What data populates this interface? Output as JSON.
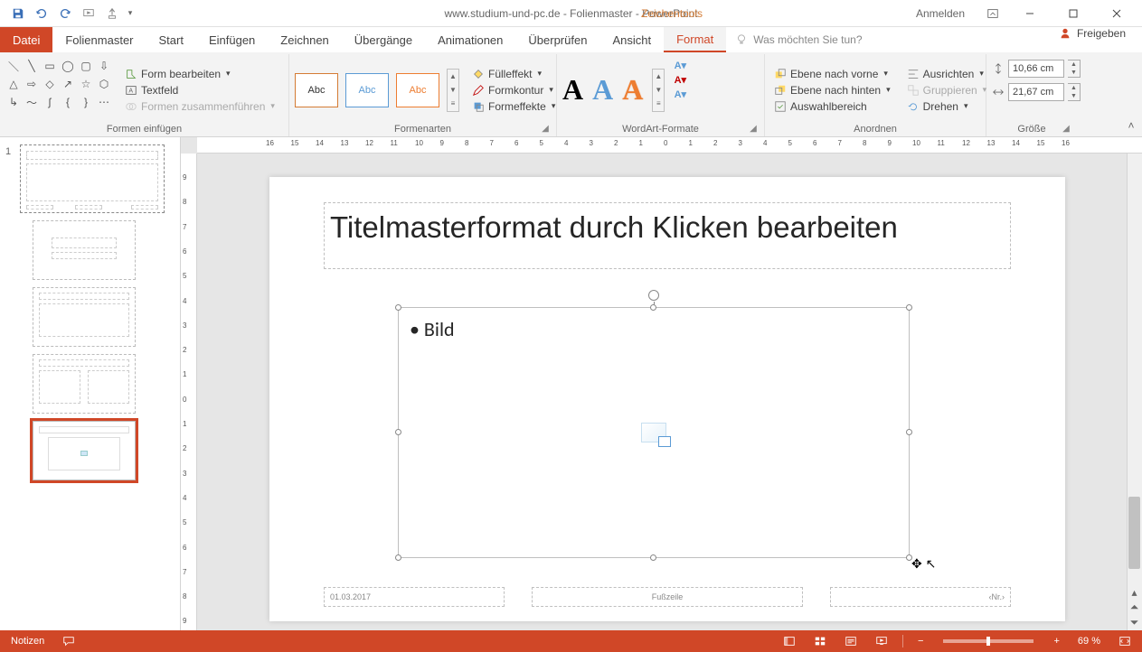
{
  "title": "www.studium-und-pc.de - Folienmaster - PowerPoint",
  "tool_context": "Zeichentools",
  "signin": "Anmelden",
  "tabs": {
    "file": "Datei",
    "items": [
      "Folienmaster",
      "Start",
      "Einfügen",
      "Zeichnen",
      "Übergänge",
      "Animationen",
      "Überprüfen",
      "Ansicht",
      "Format"
    ],
    "active": "Format",
    "tellme_placeholder": "Was möchten Sie tun?",
    "share": "Freigeben"
  },
  "ribbon": {
    "groups": {
      "insert_shapes": {
        "label": "Formen einfügen",
        "edit_shape": "Form bearbeiten",
        "textbox": "Textfeld",
        "merge_shapes": "Formen zusammenführen"
      },
      "shape_styles": {
        "label": "Formenarten",
        "abc": "Abc",
        "fill": "Fülleffekt",
        "outline": "Formkontur",
        "effects": "Formeffekte"
      },
      "wordart_styles": {
        "label": "WordArt-Formate"
      },
      "arrange": {
        "label": "Anordnen",
        "bring_forward": "Ebene nach vorne",
        "send_backward": "Ebene nach hinten",
        "selection_pane": "Auswahlbereich",
        "align": "Ausrichten",
        "group": "Gruppieren",
        "rotate": "Drehen"
      },
      "size": {
        "label": "Größe",
        "height": "10,66 cm",
        "width": "21,67 cm"
      }
    }
  },
  "thumbnails": {
    "master_number": "1"
  },
  "slide": {
    "title_placeholder": "Titelmasterformat durch Klicken bearbeiten",
    "body_bullet": "• Bild",
    "date": "01.03.2017",
    "footer": "Fußzeile",
    "number": "‹Nr.›"
  },
  "ruler": {
    "h": [
      "16",
      "15",
      "14",
      "13",
      "12",
      "11",
      "10",
      "9",
      "8",
      "7",
      "6",
      "5",
      "4",
      "3",
      "2",
      "1",
      "0",
      "1",
      "2",
      "3",
      "4",
      "5",
      "6",
      "7",
      "8",
      "9",
      "10",
      "11",
      "12",
      "13",
      "14",
      "15",
      "16"
    ],
    "v": [
      "9",
      "8",
      "7",
      "6",
      "5",
      "4",
      "3",
      "2",
      "1",
      "0",
      "1",
      "2",
      "3",
      "4",
      "5",
      "6",
      "7",
      "8",
      "9"
    ]
  },
  "statusbar": {
    "notes": "Notizen",
    "zoom_pct": "69 %"
  }
}
